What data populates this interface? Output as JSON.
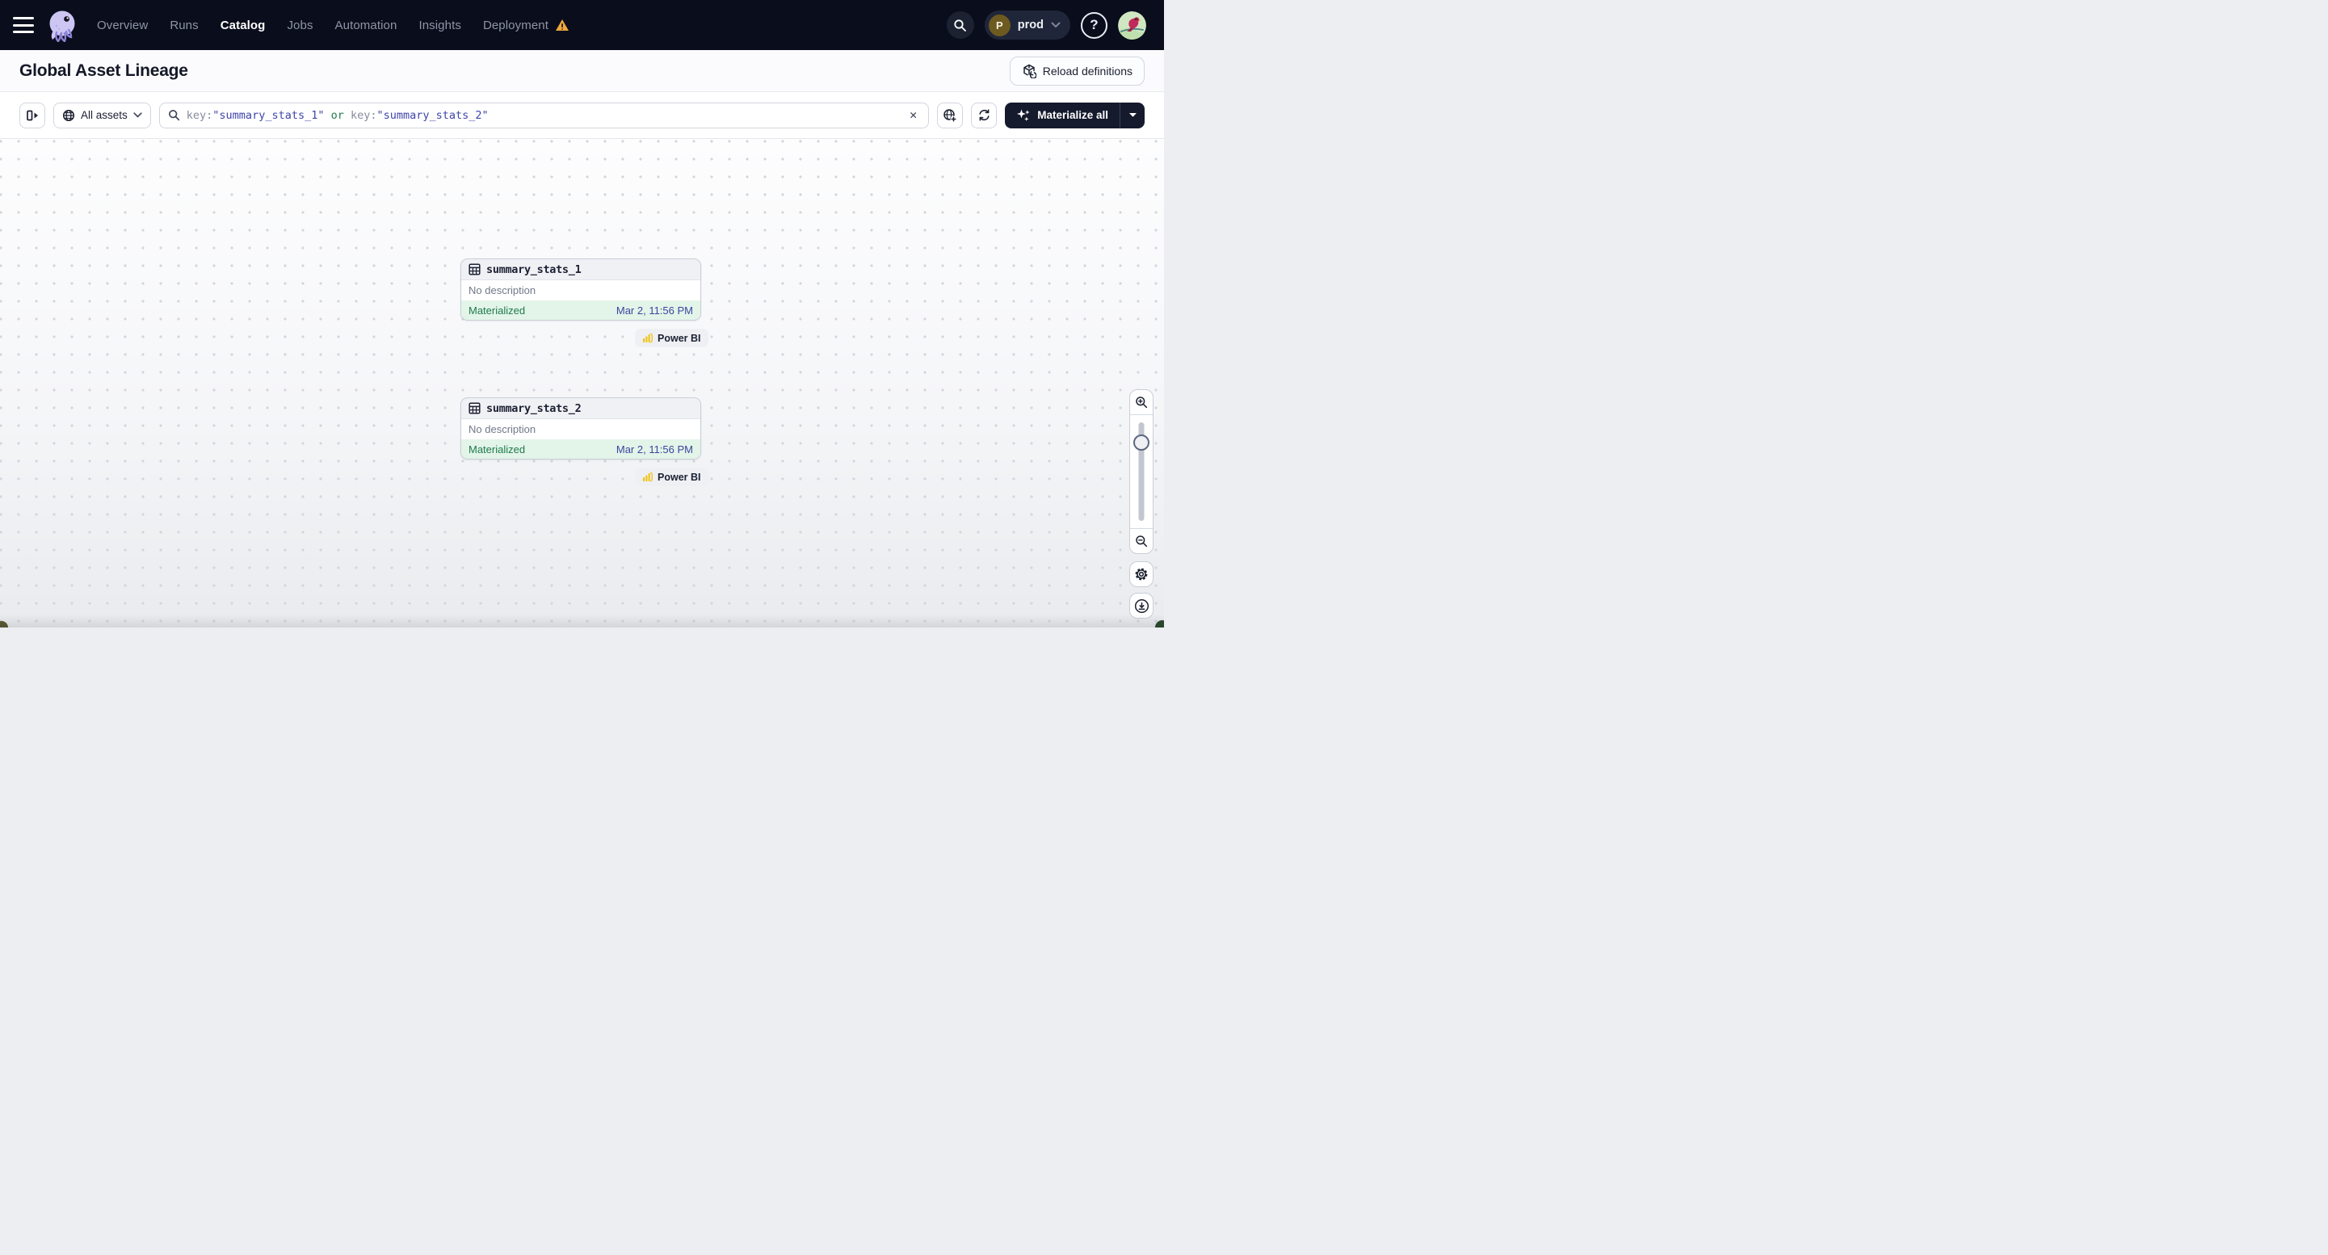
{
  "navbar": {
    "items": [
      {
        "label": "Overview"
      },
      {
        "label": "Runs"
      },
      {
        "label": "Catalog"
      },
      {
        "label": "Jobs"
      },
      {
        "label": "Automation"
      },
      {
        "label": "Insights"
      },
      {
        "label": "Deployment"
      }
    ],
    "active_item": "Catalog",
    "workspace": {
      "initial": "P",
      "name": "prod"
    },
    "help_label": "?",
    "icons": [
      "hamburger-icon",
      "dagster-logo",
      "warning-icon",
      "search-icon",
      "help-icon",
      "user-avatar"
    ]
  },
  "header": {
    "title": "Global Asset Lineage",
    "reload_button_label": "Reload definitions"
  },
  "toolbar": {
    "asset_filter_label": "All assets",
    "search": {
      "key1": "key:",
      "value1": "\"summary_stats_1\"",
      "operator": " or ",
      "key2": "key:",
      "value2": "\"summary_stats_2\""
    },
    "clear_label": "✕",
    "materialize_label": "Materialize all",
    "icons": [
      "panel-toggle-icon",
      "globe-icon",
      "search-icon",
      "clear-icon",
      "globe-add-icon",
      "refresh-icon",
      "sparkles-icon",
      "caret-down-icon"
    ]
  },
  "canvas": {
    "nodes": [
      {
        "name": "summary_stats_1",
        "description": "No description",
        "status": "Materialized",
        "timestamp": "Mar 2, 11:56 PM",
        "tag": "Power BI"
      },
      {
        "name": "summary_stats_2",
        "description": "No description",
        "status": "Materialized",
        "timestamp": "Mar 2, 11:56 PM",
        "tag": "Power BI"
      }
    ],
    "controls": [
      "zoom-in-icon",
      "zoom-slider",
      "zoom-out-icon",
      "settings-gear-icon",
      "download-icon"
    ]
  },
  "colors": {
    "navbar_bg": "#0a0d1b",
    "accent_dark_button": "#151a2c",
    "materialized_bg": "#e3f4e9",
    "materialized_text": "#1d7a4a",
    "timestamp_text": "#3b459f",
    "query_value": "#3e45a8",
    "query_operator": "#2a7d4f",
    "warning_amber": "#efa83c",
    "powerbi_yellow": "#f0c419",
    "logo_lavender": "#cdc6f3"
  }
}
